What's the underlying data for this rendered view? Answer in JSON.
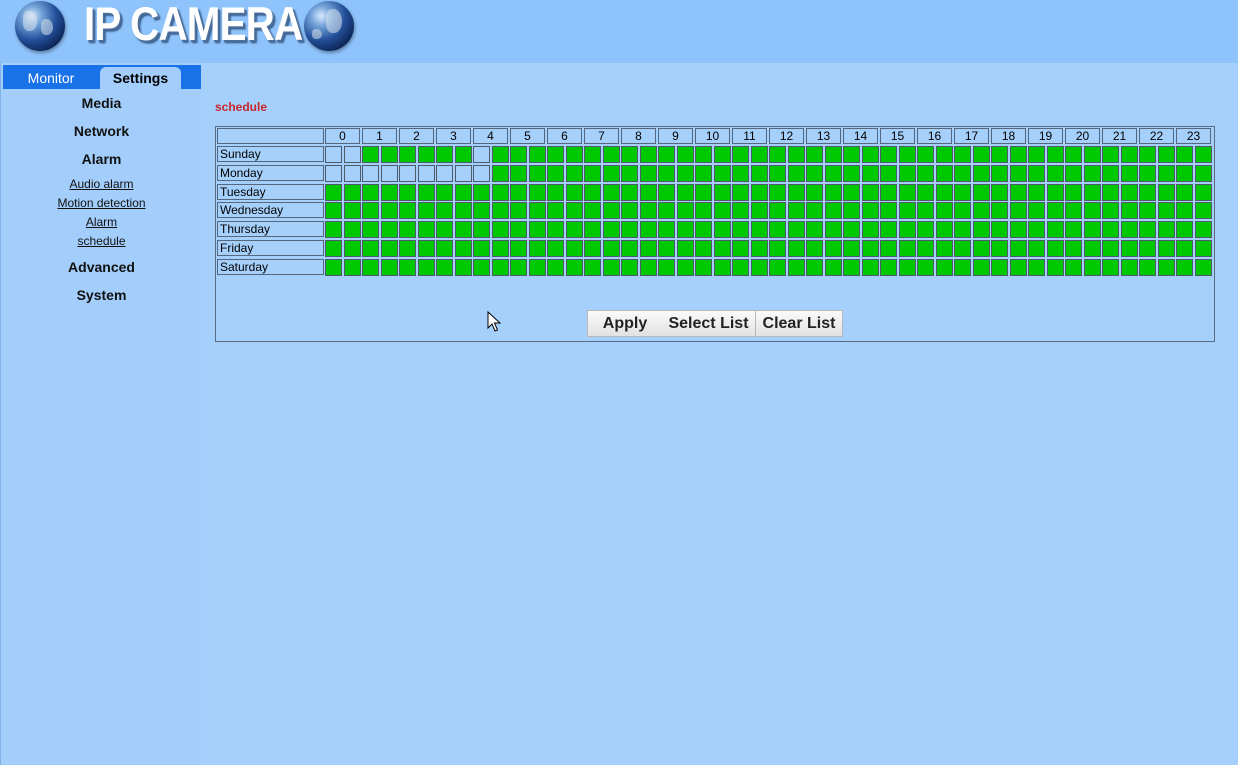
{
  "header": {
    "title": "IP CAMERA"
  },
  "tabs": {
    "monitor": "Monitor",
    "settings": "Settings"
  },
  "sidebar": {
    "media": "Media",
    "network": "Network",
    "alarm": "Alarm",
    "alarm_items": [
      "Audio alarm",
      "Motion detection",
      "Alarm",
      "schedule"
    ],
    "advanced": "Advanced",
    "system": "System"
  },
  "main": {
    "section_title": "schedule",
    "hours": [
      "0",
      "1",
      "2",
      "3",
      "4",
      "5",
      "6",
      "7",
      "8",
      "9",
      "10",
      "11",
      "12",
      "13",
      "14",
      "15",
      "16",
      "17",
      "18",
      "19",
      "20",
      "21",
      "22",
      "23"
    ],
    "days": [
      {
        "name": "Sunday",
        "off_slots": [
          0,
          1,
          8
        ]
      },
      {
        "name": "Monday",
        "off_slots": [
          0,
          1,
          2,
          3,
          4,
          5,
          6,
          7,
          8
        ]
      },
      {
        "name": "Tuesday",
        "off_slots": []
      },
      {
        "name": "Wednesday",
        "off_slots": []
      },
      {
        "name": "Thursday",
        "off_slots": []
      },
      {
        "name": "Friday",
        "off_slots": []
      },
      {
        "name": "Saturday",
        "off_slots": []
      }
    ],
    "slot_on_color": "#00c800",
    "slot_off_color": "#a6d0fc",
    "buttons": {
      "apply": "Apply",
      "select": "Select List",
      "clear": "Clear List"
    }
  }
}
